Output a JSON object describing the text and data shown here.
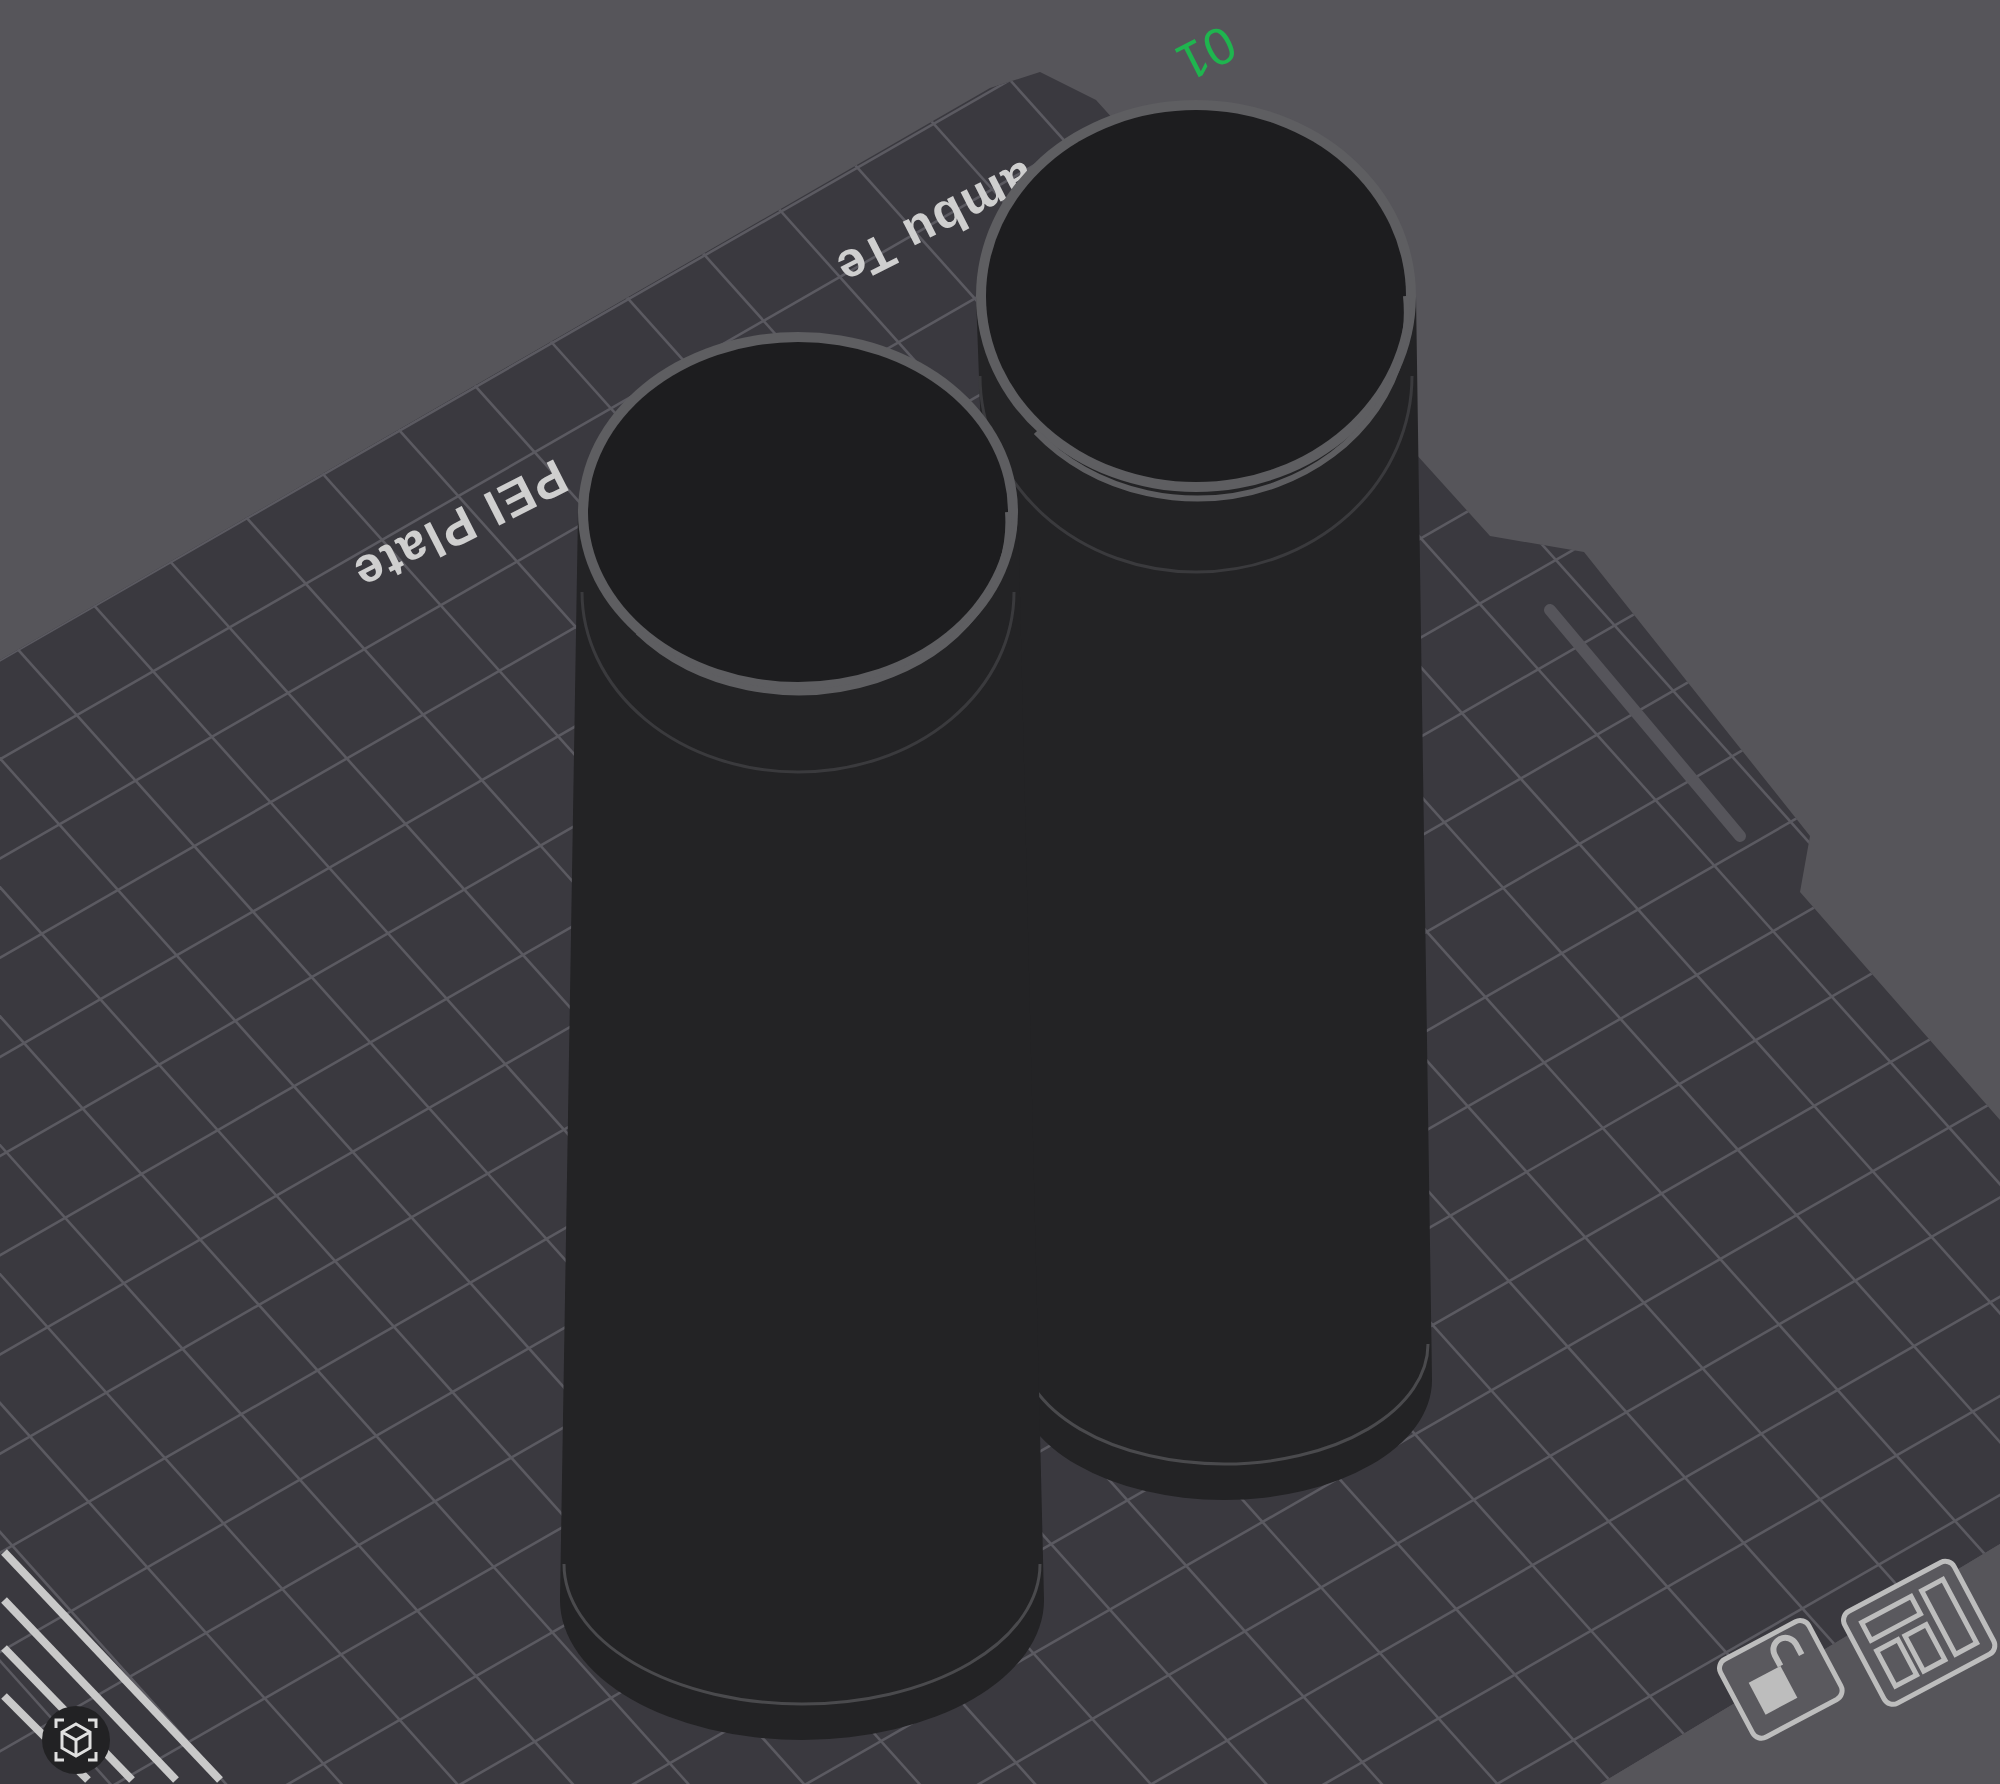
{
  "viewport": {
    "plate_label_parts": [
      "ambu Te",
      "PEI Plate"
    ],
    "plate_number": "01"
  },
  "toolbar": [
    {
      "kind": "lock"
    },
    {
      "kind": "arrange"
    }
  ]
}
